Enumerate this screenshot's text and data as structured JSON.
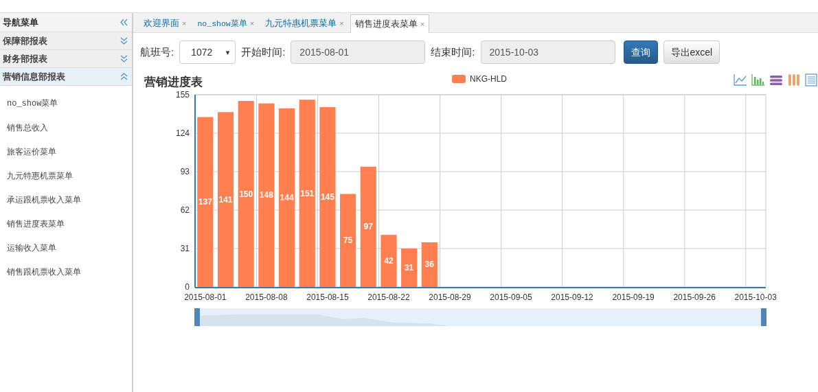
{
  "sidebar": {
    "title": "导航菜单",
    "sections": [
      {
        "label": "保障部报表",
        "expanded": false
      },
      {
        "label": "财务部报表",
        "expanded": false
      },
      {
        "label": "营销信息部报表",
        "expanded": true,
        "items": [
          "no_show菜单",
          "销售总收入",
          "旅客运价菜单",
          "九元特惠机票菜单",
          "承运跟机票收入菜单",
          "销售进度表菜单",
          "运输收入菜单",
          "销售跟机票收入菜单"
        ]
      }
    ]
  },
  "tabs": [
    {
      "label": "欢迎界面",
      "close": "×",
      "selected": false
    },
    {
      "label": "no_show菜单",
      "close": "×",
      "selected": false
    },
    {
      "label": "九元特惠机票菜单",
      "close": "×",
      "selected": false
    },
    {
      "label": "销售进度表菜单",
      "close": "×",
      "selected": true
    }
  ],
  "filters": {
    "flight_label": "航班号:",
    "flight_value": "1072",
    "flight_arrow": "▾",
    "start_label": "开始时间:",
    "start_value": "2015-08-01",
    "end_label": "结束时间:",
    "end_value": "2015-10-03"
  },
  "buttons": [
    {
      "label": "查询",
      "kind": "primary"
    },
    {
      "label": "导出excel",
      "kind": "default"
    }
  ],
  "chart": {
    "chart_data": {
      "type": "bar",
      "title": "营销进度表",
      "series": [
        {
          "name": "NKG-HLD",
          "color": "#ff7f50",
          "values": [
            137,
            141,
            150,
            148,
            144,
            151,
            145,
            75,
            97,
            42,
            31,
            36,
            0,
            0,
            0,
            0,
            0,
            0,
            0,
            0,
            0,
            0,
            0,
            0,
            0,
            0,
            0,
            0
          ]
        }
      ],
      "categories": [
        "2015-08-01",
        null,
        null,
        "2015-08-08",
        null,
        null,
        "2015-08-15",
        null,
        null,
        "2015-08-22",
        null,
        null,
        "2015-08-29",
        null,
        null,
        "2015-09-05",
        null,
        null,
        "2015-09-12",
        null,
        null,
        "2015-09-19",
        null,
        null,
        "2015-09-26",
        null,
        null,
        "2015-10-03"
      ],
      "ylim": [
        0,
        155
      ],
      "yticks": [
        0,
        31,
        62,
        93,
        124,
        155
      ],
      "grid": true,
      "value_labels": [
        "137",
        "141",
        "150",
        "148",
        "144",
        "151",
        "145",
        "75",
        "97",
        "42",
        "31",
        "36",
        null,
        null,
        null,
        null,
        null,
        null,
        null,
        null,
        null,
        null,
        null,
        null,
        null,
        null,
        null,
        null
      ]
    }
  }
}
